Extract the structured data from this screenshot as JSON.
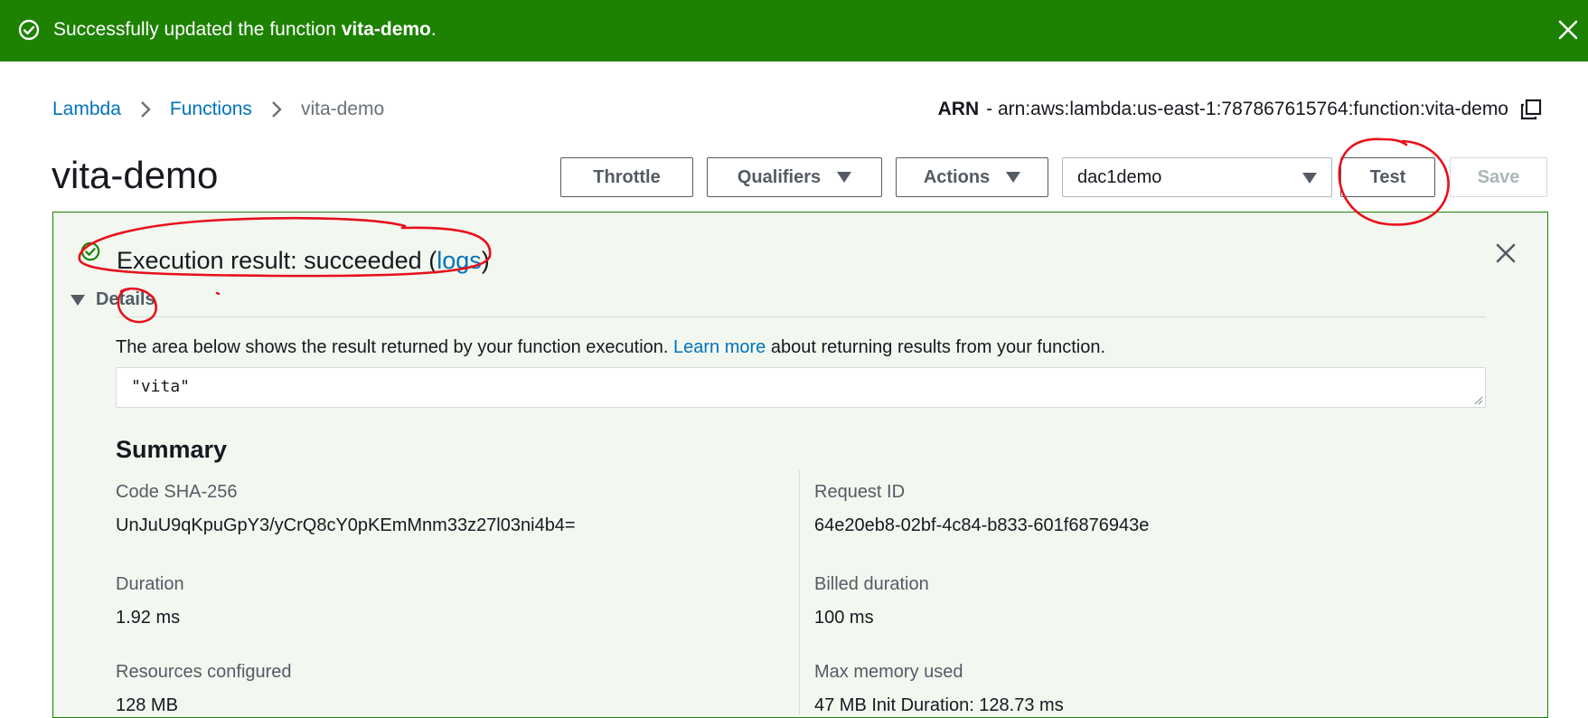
{
  "flash": {
    "prefix": "Successfully updated the function ",
    "function_name": "vita-demo",
    "suffix": "."
  },
  "breadcrumbs": {
    "items": [
      "Lambda",
      "Functions"
    ],
    "current": "vita-demo"
  },
  "arn": {
    "label": "ARN",
    "value": "- arn:aws:lambda:us-east-1:787867615764:function:vita-demo"
  },
  "page_title": "vita-demo",
  "toolbar": {
    "throttle": "Throttle",
    "qualifiers": "Qualifiers",
    "actions": "Actions",
    "test_event": "dac1demo",
    "test": "Test",
    "save": "Save"
  },
  "execution": {
    "title_prefix": "Execution result: succeeded (",
    "logs_link": "logs",
    "title_suffix": ")",
    "details_label": "Details",
    "description_prefix": "The area below shows the result returned by your function execution. ",
    "learn_more": "Learn more",
    "description_suffix": " about returning results from your function.",
    "result_value": "\"vita\""
  },
  "summary": {
    "heading": "Summary",
    "left": [
      {
        "label": "Code SHA-256",
        "value": "UnJuU9qKpuGpY3/yCrQ8cY0pKEmMnm33z27l03ni4b4="
      },
      {
        "label": "Duration",
        "value": "1.92 ms"
      },
      {
        "label": "Resources configured",
        "value": "128 MB"
      }
    ],
    "right": [
      {
        "label": "Request ID",
        "value": "64e20eb8-02bf-4c84-b833-601f6876943e"
      },
      {
        "label": "Billed duration",
        "value": "100 ms"
      },
      {
        "label": "Max memory used",
        "value": "47 MB Init Duration: 128.73 ms"
      }
    ]
  },
  "colors": {
    "success_green": "#1d8102",
    "link_blue": "#0073bb",
    "annotation_red": "#e8101a"
  }
}
